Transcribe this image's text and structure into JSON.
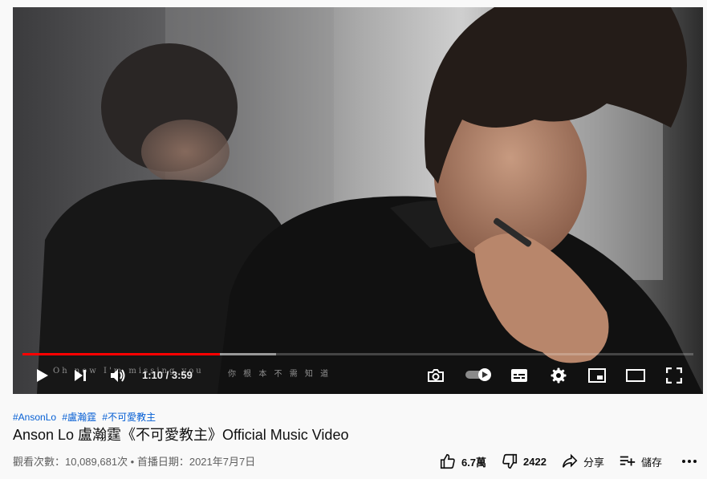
{
  "player": {
    "subtitle_en": "Oh now I'm missing you",
    "subtitle_zh": "你 根 本 不 需 知 道",
    "time": "1:10 / 3:59",
    "played_fraction": 0.294,
    "buffered_fraction": 0.378,
    "accent_color": "#ff0000",
    "icons": [
      "play-icon",
      "next-icon",
      "volume-icon",
      "screenshot-icon",
      "autoplay-toggle",
      "subtitles-icon",
      "settings-icon",
      "miniplayer-icon",
      "theater-icon",
      "fullscreen-icon"
    ]
  },
  "video": {
    "hashtags": [
      "#AnsonLo",
      "#盧瀚霆",
      "#不可愛教主"
    ],
    "title": "Anson Lo 盧瀚霆《不可愛教主》Official Music Video",
    "meta": "觀看次數：10,089,681次 • 首播日期：2021年7月7日"
  },
  "actions": {
    "like_count": "6.7萬",
    "dislike_count": "2422",
    "share_label": "分享",
    "save_label": "儲存"
  }
}
